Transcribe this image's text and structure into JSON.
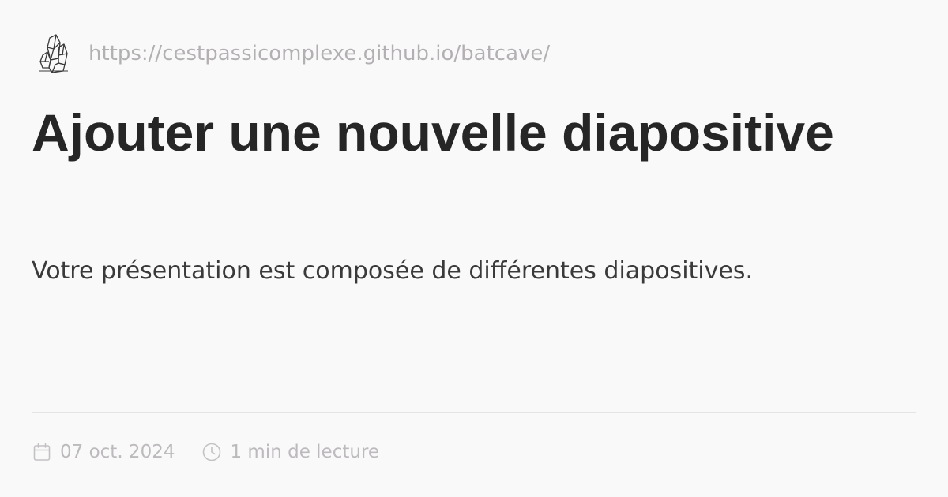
{
  "site": {
    "logo_icon": "crystal-cluster-icon",
    "url": "https://cestpassicomplexe.github.io/batcave/"
  },
  "article": {
    "title": "Ajouter une nouvelle diapositive",
    "description": "Votre présentation est composée de différentes diapositives."
  },
  "meta": {
    "date_icon": "calendar-icon",
    "date": "07 oct. 2024",
    "reading_icon": "clock-icon",
    "reading_time": "1 min de lecture"
  },
  "colors": {
    "background": "#faf9fa",
    "title": "#262626",
    "muted": "#b3b0b3"
  }
}
